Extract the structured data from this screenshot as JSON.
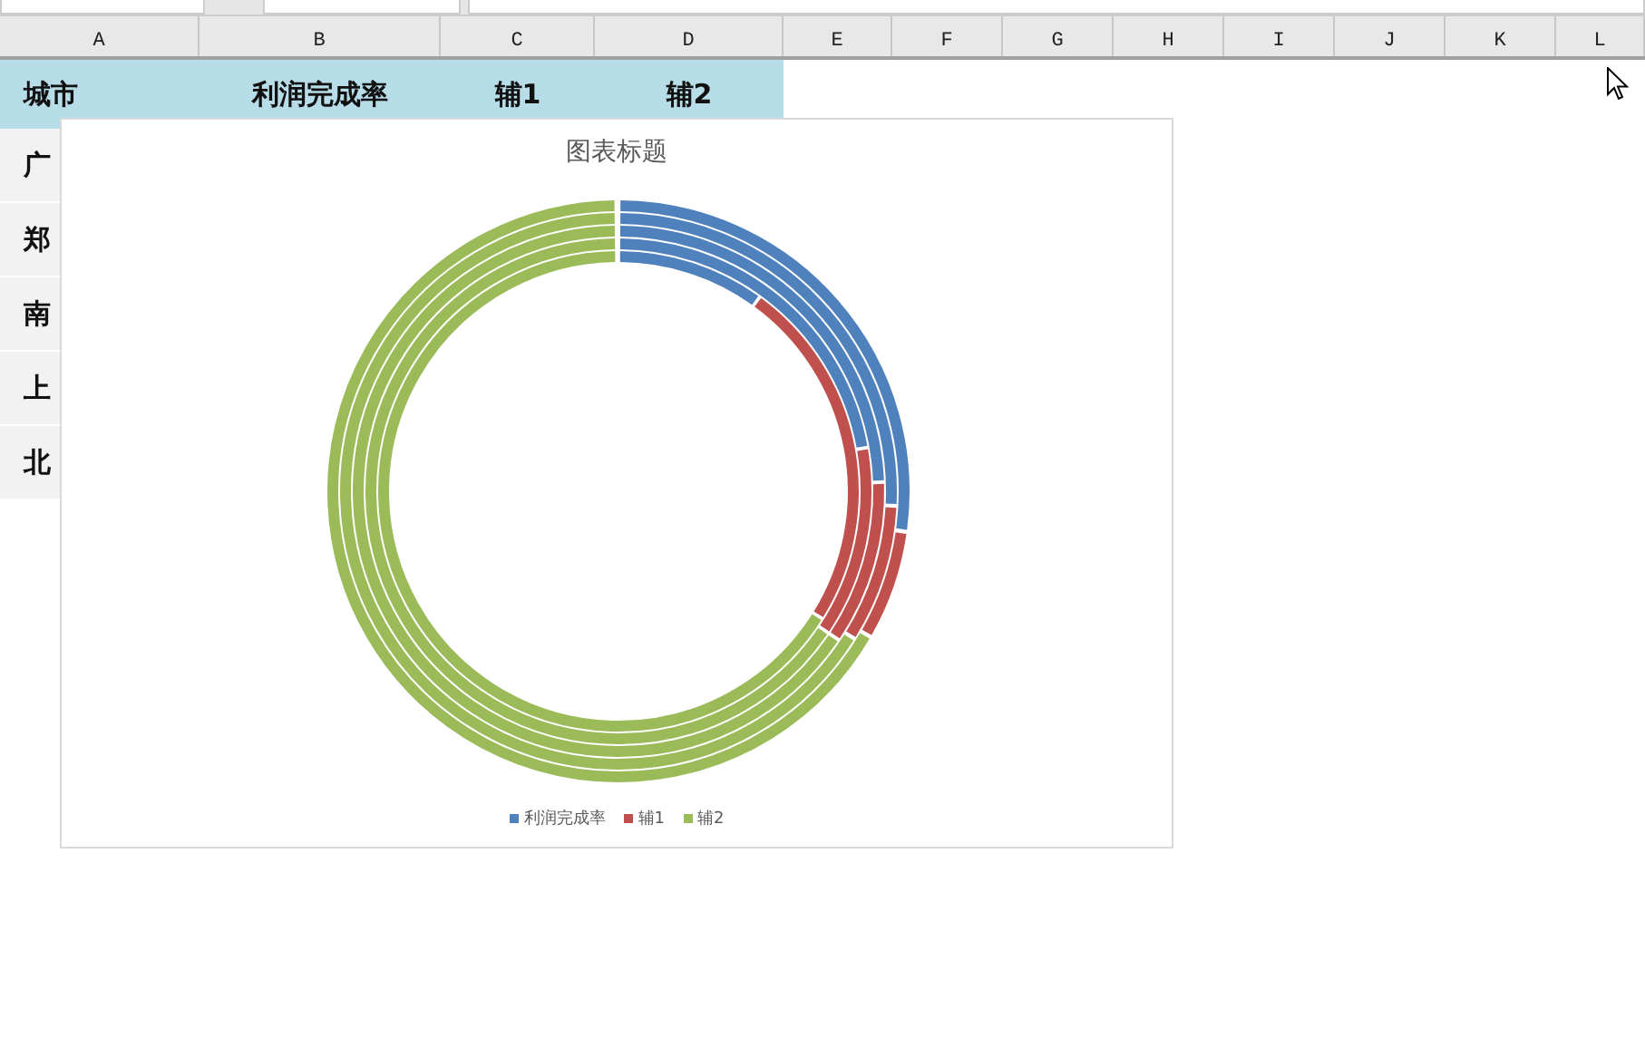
{
  "columns": [
    "A",
    "B",
    "C",
    "D",
    "E",
    "F",
    "G",
    "H",
    "I",
    "J",
    "K",
    "L"
  ],
  "table": {
    "header": [
      "城市",
      "利润完成率",
      "辅1",
      "辅2"
    ],
    "rows": [
      [
        "广"
      ],
      [
        "郑"
      ],
      [
        "南"
      ],
      [
        "上"
      ],
      [
        "北"
      ]
    ]
  },
  "chart": {
    "title": "图表标题",
    "legend": [
      {
        "label": "利润完成率",
        "color": "#4f81bd"
      },
      {
        "label": "辅1",
        "color": "#c0504d"
      },
      {
        "label": "辅2",
        "color": "#9bbb59"
      }
    ]
  }
}
